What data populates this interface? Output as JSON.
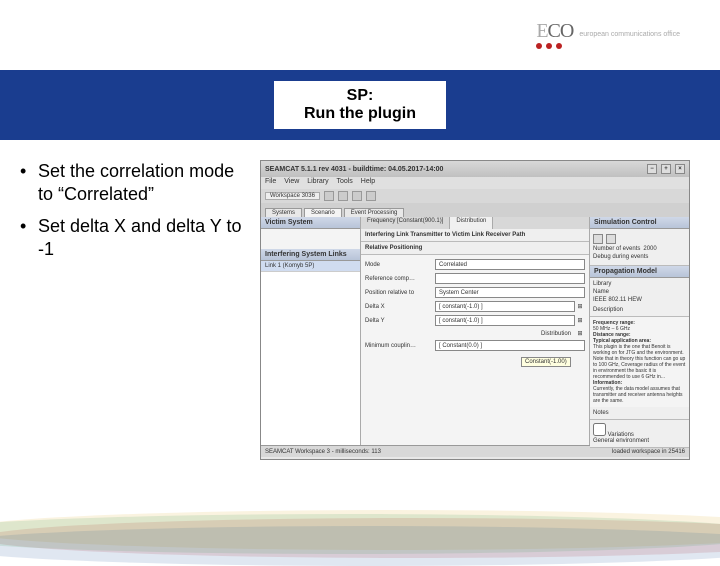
{
  "logo": {
    "brand": "ECO",
    "subtitle": "european communications office"
  },
  "title": {
    "line1": "SP:",
    "line2": "Run the plugin"
  },
  "bullets": [
    "Set the correlation mode to “Correlated”",
    "Set delta X and delta Y to -1"
  ],
  "screenshot": {
    "window_title": "SEAMCAT 5.1.1 rev 4031 - buildtime: 04.05.2017-14:00",
    "menus": [
      "File",
      "View",
      "Library",
      "Tools",
      "Help"
    ],
    "workspace_tab": "Workspace 3036",
    "main_tabs": [
      "Systems",
      "Scenario",
      "Event Processing"
    ],
    "left": {
      "victim_header": "Victim System",
      "interfering_header": "Interfering System Links",
      "item": "Link 1 (Komyb 5P)"
    },
    "mid": {
      "tabs": [
        "Frequency [Constant(900.1)]",
        "Distribution"
      ],
      "path_label": "Interfering Link Transmitter to Victim Link Receiver Path",
      "section": "Relative Positioning",
      "rows": {
        "mode": {
          "label": "Mode",
          "value": "Correlated"
        },
        "ref": {
          "label": "Reference comp…",
          "value": ""
        },
        "pos": {
          "label": "Position relative to",
          "value": "System Center"
        },
        "dx": {
          "label": "Delta X",
          "value": "[ constant(-1.0) ]"
        },
        "dy": {
          "label": "Delta Y",
          "value": "[ constant(-1.0) ]"
        },
        "min": {
          "label": "Minimum couplin…",
          "value": "[ Constant(0.0) ]"
        }
      },
      "tooltip": "Constant(-1.00)",
      "dist_label": "Distribution"
    },
    "right": {
      "sim_header": "Simulation Control",
      "events_label": "Number of events",
      "events_value": "2000",
      "debug_label": "Debug during events",
      "prop_header": "Propagation Model",
      "library_label": "Library",
      "name_label": "Name",
      "name_value": "IEEE 802.11 HEW",
      "desc_label": "Description",
      "desc_header1": "Frequency range:",
      "desc_line1": "50 MHz – 6 GHz",
      "desc_header2": "Distance range:",
      "desc_header3": "Typical application area:",
      "desc_body": "This plugin is the one that Benoit is working on for JTG and the environment. Note that in theory this function can go up to 100 GHz, Coverage radius of the event in environment the basic it is recommended to use 6 GHz in...",
      "desc_header4": "Information:",
      "desc_body2": "Currently, the data model assumes that transmitter and receiver antenna heights are the same.",
      "notes_label": "Notes",
      "variations_label": "Variations",
      "general_label": "General environment"
    },
    "status": {
      "left": "SEAMCAT Workspace 3 - milliseconds: 113",
      "right": "loaded workspace in 25416"
    }
  }
}
